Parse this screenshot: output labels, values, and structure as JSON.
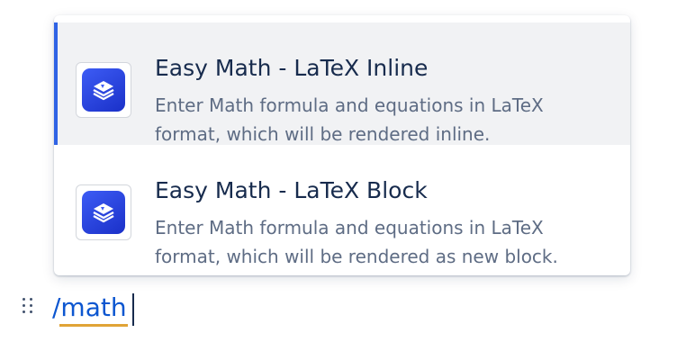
{
  "menu": {
    "items": [
      {
        "title": "Easy Math - LaTeX Inline",
        "description": "Enter Math formula and equations in LaTeX\nformat, which will be rendered inline.",
        "icon": "easy-math-app-icon",
        "selected": true
      },
      {
        "title": "Easy Math - LaTeX Block",
        "description": "Enter Math formula and equations in LaTeX\nformat, which will be rendered as new block.",
        "icon": "easy-math-app-icon",
        "selected": false
      }
    ]
  },
  "editor": {
    "command_text": "/math",
    "drag_handle_icon": "drag-handle-icon"
  },
  "colors": {
    "accent": "#2f63e5",
    "command_text": "#0c56d0",
    "underline": "#e0a336",
    "selected_bg": "#f1f2f4",
    "icon_gradient_start": "#3d5cf5",
    "icon_gradient_end": "#1a30c8"
  }
}
